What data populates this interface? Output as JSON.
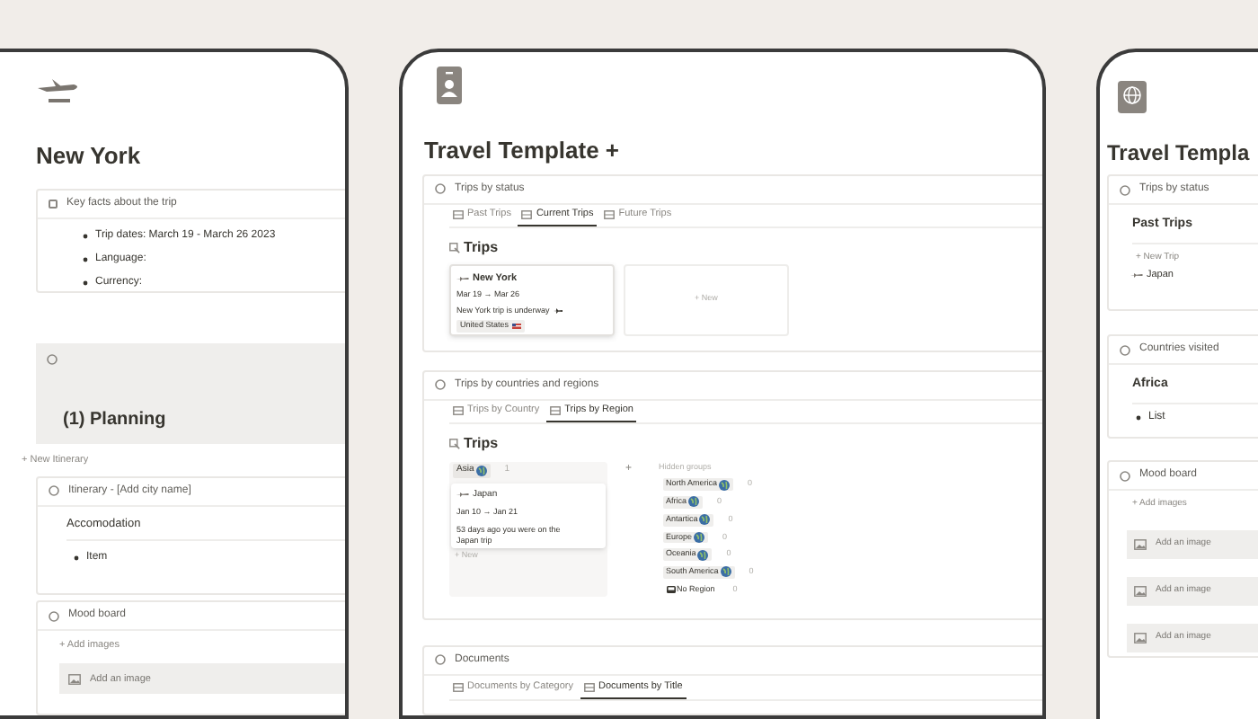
{
  "left_page": {
    "title": "New York",
    "key_facts": {
      "label": "Key facts about the trip",
      "checked": false,
      "items": [
        "Trip dates: March 19 - March 26 2023",
        "Language:",
        "Currency:"
      ]
    },
    "planning": {
      "heading": "(1) Planning"
    },
    "new_itinerary": "+ New Itinerary",
    "itinerary": {
      "label": "Itinerary - [Add city name]",
      "heading": "Accomodation",
      "items": [
        "Item"
      ]
    },
    "mood_board": {
      "label": "Mood board",
      "add": "+ Add images",
      "images": [
        "Add an image"
      ]
    }
  },
  "middle_page": {
    "title": "Travel Template +",
    "status_section": {
      "label": "Trips by status",
      "tabs": [
        {
          "label": "Past Trips",
          "selected": false
        },
        {
          "label": "Current Trips",
          "selected": true
        },
        {
          "label": "Future Trips",
          "selected": false
        }
      ],
      "heading": "Trips",
      "card": {
        "title": "New York",
        "dates": "Mar 19 → Mar 26",
        "note": "New York trip is underway",
        "tag": "United States"
      },
      "new": "+ New"
    },
    "region_section": {
      "label": "Trips by countries and regions",
      "tabs": [
        {
          "label": "Trips by Country",
          "selected": false
        },
        {
          "label": "Trips by Region",
          "selected": true
        }
      ],
      "heading": "Trips",
      "column": {
        "name": "Asia",
        "count": "1",
        "card": {
          "title": "Japan",
          "dates": "Jan 10 → Jan 21",
          "note": "53 days ago you were on the Japan trip"
        },
        "new": "+ New"
      },
      "add": "+",
      "hidden_label": "Hidden groups",
      "groups": [
        {
          "name": "North America",
          "count": "0",
          "kind": "region"
        },
        {
          "name": "Africa",
          "count": "0",
          "kind": "region"
        },
        {
          "name": "Antartica",
          "count": "0",
          "kind": "region"
        },
        {
          "name": "Europe",
          "count": "0",
          "kind": "region"
        },
        {
          "name": "Oceania",
          "count": "0",
          "kind": "region"
        },
        {
          "name": "South America",
          "count": "0",
          "kind": "region"
        },
        {
          "name": "No Region",
          "count": "0",
          "kind": "none"
        }
      ]
    },
    "documents_section": {
      "label": "Documents",
      "tabs": [
        {
          "label": "Documents by Category",
          "selected": false
        },
        {
          "label": "Documents by Title",
          "selected": true
        }
      ]
    }
  },
  "right_page": {
    "title": "Travel Templa",
    "status_section": {
      "label": "Trips by status",
      "heading": "Past Trips",
      "new": "+ New Trip",
      "items": [
        "Japan"
      ]
    },
    "countries_section": {
      "label": "Countries visited",
      "heading": "Africa",
      "items": [
        "List"
      ]
    },
    "mood_board": {
      "label": "Mood board",
      "add": "+ Add images",
      "images": [
        "Add an image",
        "Add an image",
        "Add an image"
      ]
    }
  }
}
